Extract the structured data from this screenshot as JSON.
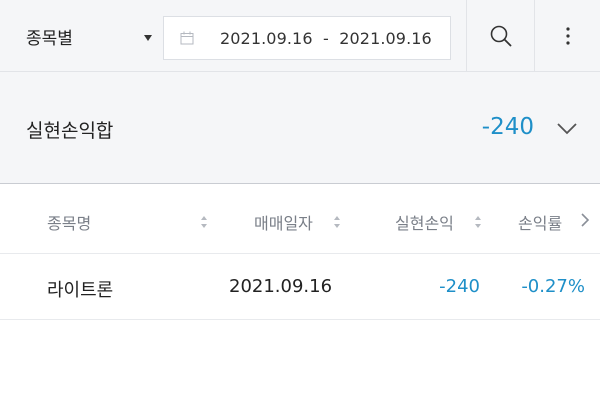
{
  "filter": {
    "category_label": "종목별",
    "date_range": "2021.09.16  -  2021.09.16",
    "calendar_icon": "calendar-icon",
    "search_icon": "search-icon",
    "more_icon": "more-vertical-icon"
  },
  "summary": {
    "title": "실현손익합",
    "value": "-240",
    "toggle_icon": "chevron-down-icon"
  },
  "table": {
    "headers": [
      "종목명",
      "매매일자",
      "실현손익",
      "손익률"
    ],
    "rows": [
      {
        "name": "라이트론",
        "date": "2021.09.16",
        "pnl": "-240",
        "rate": "-0.27%"
      }
    ]
  },
  "colors": {
    "accent": "#1e8fc8",
    "background": "#f5f6f8",
    "header_text": "#7a7f88"
  }
}
